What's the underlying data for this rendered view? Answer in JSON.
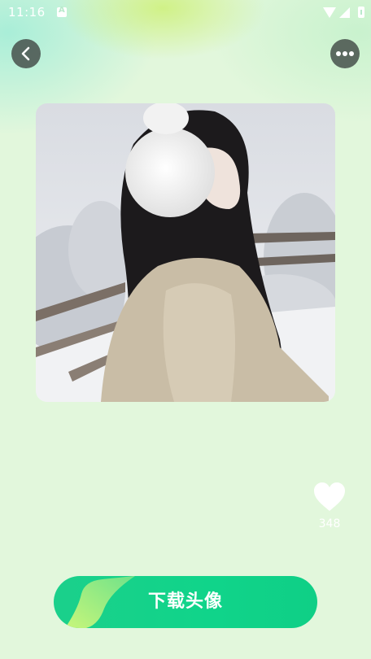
{
  "status_bar": {
    "time": "11:16"
  },
  "header": {
    "back_icon": "chevron-left-icon",
    "more_icon": "more-horizontal-icon"
  },
  "like": {
    "count": "348",
    "icon": "heart-icon"
  },
  "download": {
    "label": "下载头像"
  },
  "colors": {
    "accent": "#10d48a",
    "accent_light": "#b9f27a",
    "background": "#e2f7dc"
  }
}
